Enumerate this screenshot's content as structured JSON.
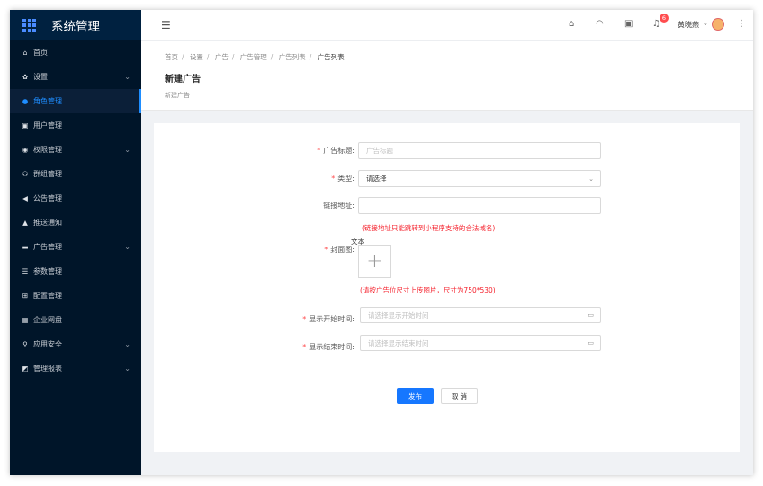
{
  "app": {
    "title": "系统管理"
  },
  "sidebar": {
    "items": [
      {
        "label": "首页",
        "icon": "home-icon",
        "glyph": "⌂",
        "has_children": false,
        "active": false
      },
      {
        "label": "设置",
        "icon": "gear-icon",
        "glyph": "✿",
        "has_children": true,
        "active": false
      },
      {
        "label": "角色管理",
        "icon": "user-circle-icon",
        "glyph": "●",
        "has_children": false,
        "active": true
      },
      {
        "label": "用户管理",
        "icon": "id-card-icon",
        "glyph": "▣",
        "has_children": false,
        "active": false
      },
      {
        "label": "权限管理",
        "icon": "shield-check-icon",
        "glyph": "◉",
        "has_children": true,
        "active": false
      },
      {
        "label": "群组管理",
        "icon": "users-icon",
        "glyph": "⚇",
        "has_children": false,
        "active": false
      },
      {
        "label": "公告管理",
        "icon": "megaphone-icon",
        "glyph": "◀",
        "has_children": false,
        "active": false
      },
      {
        "label": "推送通知",
        "icon": "bell-icon",
        "glyph": "▲",
        "has_children": false,
        "active": false
      },
      {
        "label": "广告管理",
        "icon": "ad-icon",
        "glyph": "▬",
        "has_children": true,
        "active": false
      },
      {
        "label": "参数管理",
        "icon": "list-icon",
        "glyph": "☰",
        "has_children": false,
        "active": false
      },
      {
        "label": "配置管理",
        "icon": "config-icon",
        "glyph": "⊞",
        "has_children": false,
        "active": false
      },
      {
        "label": "企业网盘",
        "icon": "grid-icon",
        "glyph": "▦",
        "has_children": false,
        "active": false
      },
      {
        "label": "应用安全",
        "icon": "lock-icon",
        "glyph": "⚲",
        "has_children": true,
        "active": false
      },
      {
        "label": "管理报表",
        "icon": "chart-icon",
        "glyph": "◩",
        "has_children": true,
        "active": false
      }
    ]
  },
  "topbar": {
    "notification_count": "6",
    "username": "黄晓燕"
  },
  "breadcrumb": [
    "首页",
    "设置",
    "广告",
    "广告管理",
    "广告列表",
    "广告列表"
  ],
  "page": {
    "title": "新建广告",
    "subtitle": "新建广告"
  },
  "form": {
    "title_label": "广告标题:",
    "title_placeholder": "广告标题",
    "type_label": "类型:",
    "type_value": "请选择",
    "link_label": "链接地址:",
    "link_hint": "(链接地址只能跳转到小程序支持的合法域名)",
    "cover_label": "封面图:",
    "cover_upload_text": "文本",
    "cover_hint": "(请按广告位尺寸上传图片，尺寸为750*530)",
    "start_label": "显示开始时间:",
    "start_placeholder": "请选择显示开始时间",
    "end_label": "显示结束时间:",
    "end_placeholder": "请选择显示结束时间",
    "submit_label": "发布",
    "cancel_label": "取 消"
  },
  "colors": {
    "sidebar_bg": "#001529",
    "accent": "#1677ff",
    "required": "#ff4d4f",
    "hint": "#f5222d"
  }
}
